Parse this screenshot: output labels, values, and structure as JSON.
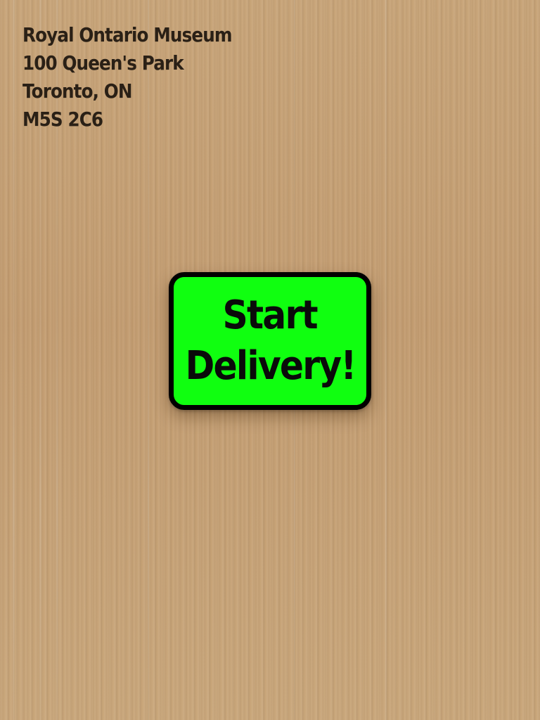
{
  "background": {
    "texture": "cardboard",
    "base_color": "#c49f74"
  },
  "address": {
    "line1": "Royal Ontario Museum",
    "line2": "100 Queen's Park",
    "line3": "Toronto, ON",
    "line4": "M5S 2C6",
    "color": "#2a2016"
  },
  "start_button": {
    "label_line1": "Start",
    "label_line2": "Delivery!",
    "fill_color": "#10ff10",
    "border_color": "#000000"
  }
}
